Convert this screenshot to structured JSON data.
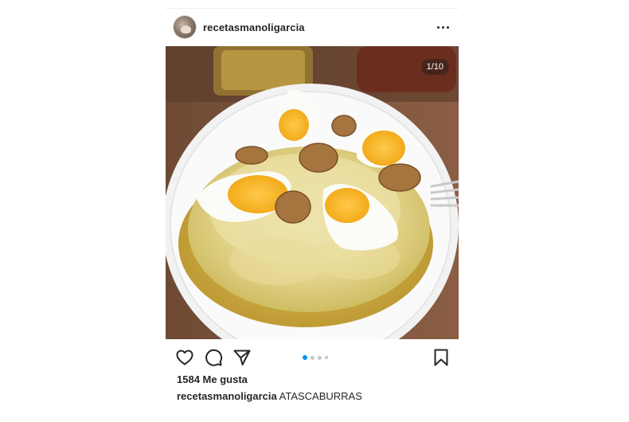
{
  "post": {
    "username": "recetasmanoligarcia",
    "media_counter": "1/10",
    "likes": "1584 Me gusta",
    "caption": {
      "username": "recetasmanoligarcia",
      "text": "ATASCABURRAS"
    },
    "carousel": {
      "total_dots": 4,
      "active_index": 0
    }
  },
  "icons": {
    "more": "more-options-icon",
    "like": "heart-icon",
    "comment": "comment-icon",
    "share": "send-icon",
    "save": "bookmark-icon"
  },
  "colors": {
    "text": "#262626",
    "active_dot": "#0095f6",
    "inactive_dot": "#c7c7c7",
    "divider": "#efefef"
  }
}
